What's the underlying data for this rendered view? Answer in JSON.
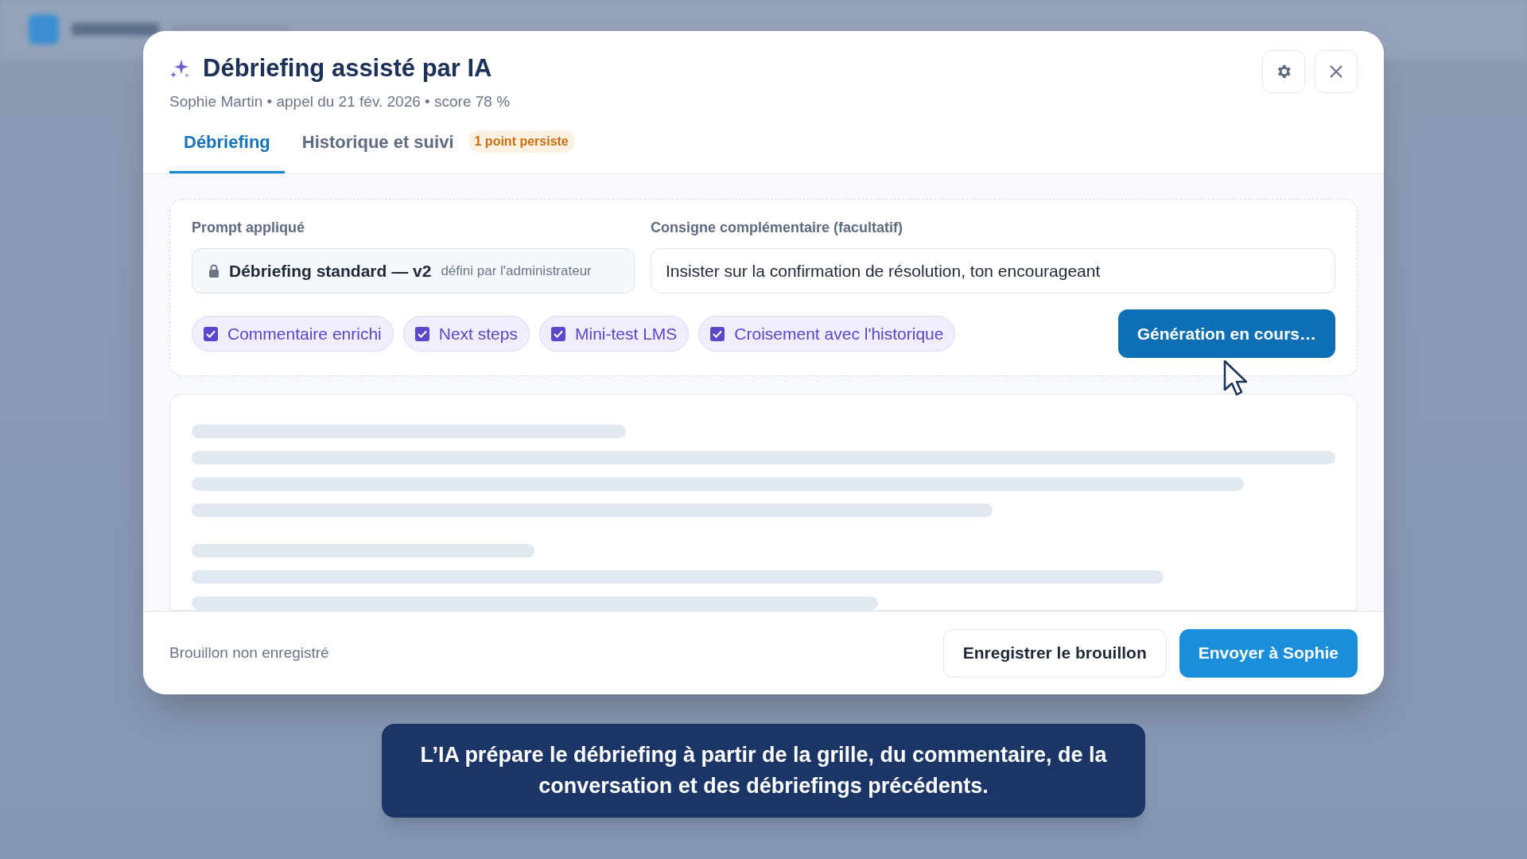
{
  "dialog": {
    "title": "Débriefing assisté par IA",
    "subtitle": "Sophie Martin • appel du 21 fév. 2026 • score 78 %"
  },
  "tabs": [
    {
      "label": "Débriefing",
      "selected": true
    },
    {
      "label": "Historique et suivi",
      "selected": false,
      "badge": "1 point persiste"
    }
  ],
  "prompt": {
    "label": "Prompt appliqué",
    "name": "Débriefing standard — v2",
    "note": "défini par l'administrateur"
  },
  "instruction": {
    "label": "Consigne complémentaire (facultatif)",
    "value": "Insister sur la confirmation de résolution, ton encourageant"
  },
  "options": [
    {
      "label": "Commentaire enrichi",
      "checked": true
    },
    {
      "label": "Next steps",
      "checked": true
    },
    {
      "label": "Mini-test LMS",
      "checked": true
    },
    {
      "label": "Croisement avec l'historique",
      "checked": true
    }
  ],
  "generate_button": {
    "label": "Génération en cours…",
    "disabled": true
  },
  "footer": {
    "status": "Brouillon non enregistré",
    "buttons": [
      {
        "label": "Enregistrer le brouillon",
        "kind": "secondary"
      },
      {
        "label": "Envoyer à Sophie",
        "kind": "primary"
      }
    ]
  },
  "caption": "L’IA prépare le débriefing à partir de la grille, du commentaire, de la conversation et des débriefings précédents."
}
